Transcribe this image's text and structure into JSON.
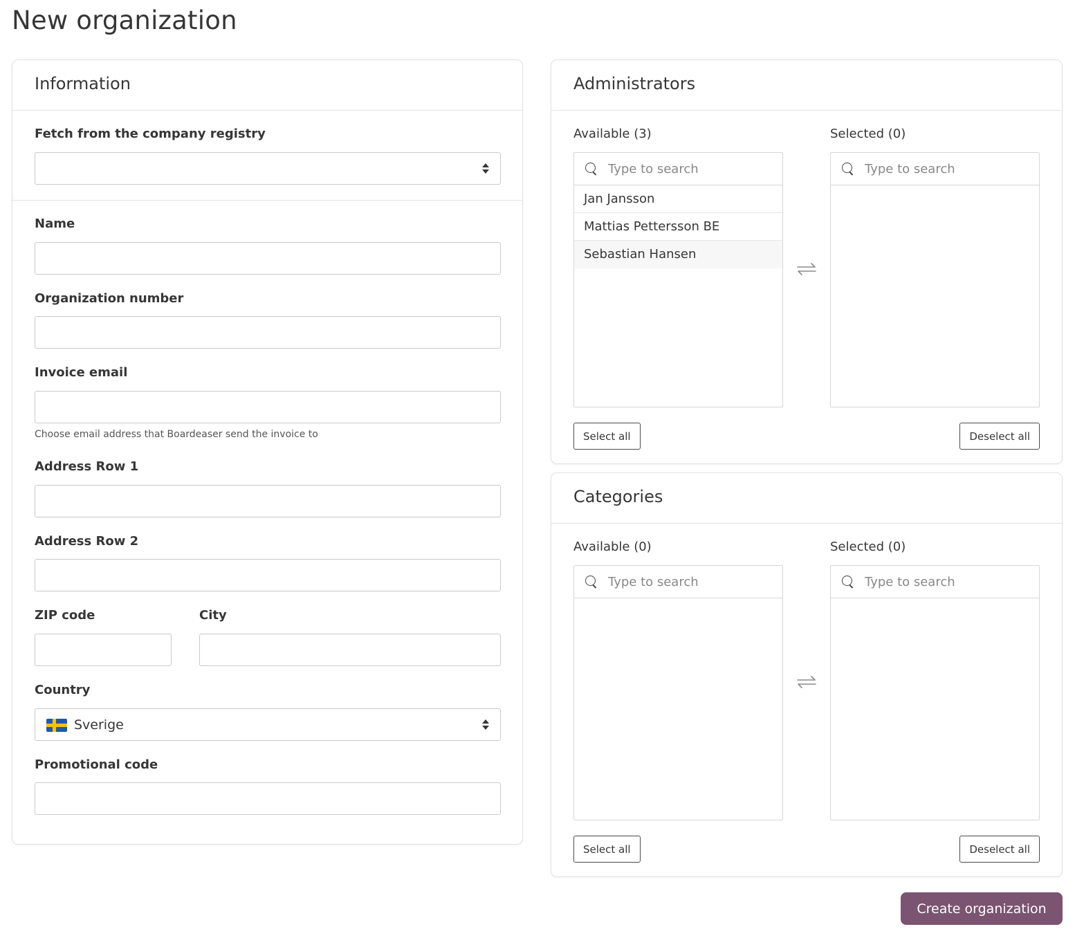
{
  "page": {
    "title": "New organization"
  },
  "information": {
    "title": "Information",
    "registry": {
      "label": "Fetch from the company registry",
      "value": ""
    },
    "name": {
      "label": "Name",
      "value": ""
    },
    "org_number": {
      "label": "Organization number",
      "value": ""
    },
    "invoice_email": {
      "label": "Invoice email",
      "value": "",
      "help": "Choose email address that Boardeaser send the invoice to"
    },
    "address1": {
      "label": "Address Row 1",
      "value": ""
    },
    "address2": {
      "label": "Address Row 2",
      "value": ""
    },
    "zip": {
      "label": "ZIP code",
      "value": ""
    },
    "city": {
      "label": "City",
      "value": ""
    },
    "country": {
      "label": "Country",
      "value": "Sverige",
      "flag": "sweden-flag"
    },
    "promo": {
      "label": "Promotional code",
      "value": ""
    }
  },
  "administrators": {
    "title": "Administrators",
    "available_label": "Available (3)",
    "selected_label": "Selected (0)",
    "search_placeholder": "Type to search",
    "available_items": [
      "Jan Jansson",
      "Mattias Pettersson BE",
      "Sebastian Hansen"
    ],
    "selected_items": [],
    "select_all": "Select all",
    "deselect_all": "Deselect all"
  },
  "categories": {
    "title": "Categories",
    "available_label": "Available (0)",
    "selected_label": "Selected (0)",
    "search_placeholder": "Type to search",
    "available_items": [],
    "selected_items": [],
    "select_all": "Select all",
    "deselect_all": "Deselect all"
  },
  "actions": {
    "create": "Create organization"
  },
  "colors": {
    "primary": "#7a5470",
    "border": "#c9c9c9"
  }
}
